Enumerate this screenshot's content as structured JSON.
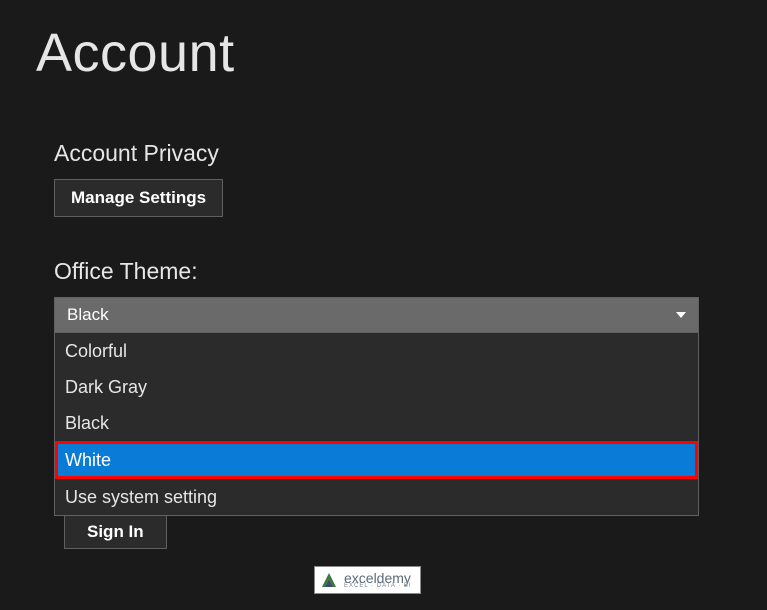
{
  "page_title": "Account",
  "privacy": {
    "heading": "Account Privacy",
    "manage_label": "Manage Settings"
  },
  "theme": {
    "heading": "Office Theme:",
    "selected": "Black",
    "options": [
      "Colorful",
      "Dark Gray",
      "Black",
      "White",
      "Use system setting"
    ],
    "highlighted_index": 3
  },
  "signin_label": "Sign In",
  "brand": {
    "name": "exceldemy",
    "tagline": "EXCEL · DATA · BI"
  }
}
